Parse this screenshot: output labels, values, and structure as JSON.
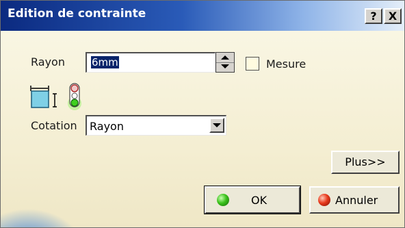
{
  "window": {
    "title": "Edition de contrainte",
    "help_label": "?",
    "close_label": "X"
  },
  "radius": {
    "label": "Rayon",
    "value": "6mm",
    "measure_label": "Mesure",
    "measure_checked": false
  },
  "icons": {
    "dimension": "dimension-icon",
    "constraint_status": "traffic-light-icon"
  },
  "dimensioning": {
    "label": "Cotation",
    "selected": "Rayon"
  },
  "buttons": {
    "more_label": "Plus>>",
    "ok_label": "OK",
    "cancel_label": "Annuler"
  },
  "colors": {
    "title_start": "#0b2a80",
    "title_end": "#e4eef9",
    "background": "#f7f3dc",
    "selection": "#0a246a"
  }
}
